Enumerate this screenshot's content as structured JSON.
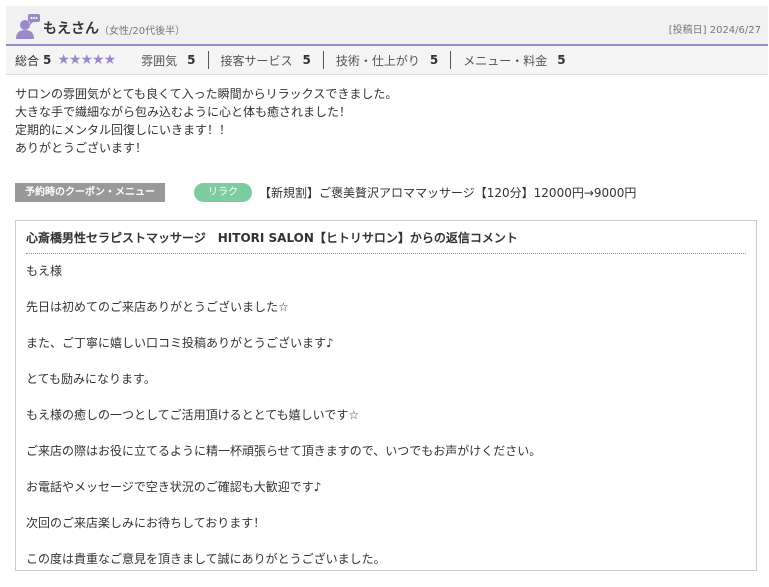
{
  "reviewer": {
    "name": "もえさん",
    "attributes": "（女性/20代後半）",
    "date": "[投稿日] 2024/6/27"
  },
  "ratings": {
    "total_label": "総合",
    "total_value": "5",
    "stars": "★★★★★",
    "categories": [
      {
        "label": "雰囲気",
        "value": "5"
      },
      {
        "label": "接客サービス",
        "value": "5"
      },
      {
        "label": "技術・仕上がり",
        "value": "5"
      },
      {
        "label": "メニュー・料金",
        "value": "5"
      }
    ]
  },
  "review_lines": [
    "サロンの雰囲気がとても良くて入った瞬間からリラックスできました。",
    "大きな手で繊細ながら包み込むように心と体も癒されました！",
    "定期的にメンタル回復しにいきます！！",
    "ありがとうございます！"
  ],
  "coupon": {
    "tag": "予約時のクーポン・メニュー",
    "badge": "リラク",
    "text": "【新規割】ご褒美贅沢アロママッサージ【120分】12000円→9000円"
  },
  "reply": {
    "title": "心斎橋男性セラピストマッサージ　HITORI SALON【ヒトリサロン】からの返信コメント",
    "lines": [
      "もえ様",
      "先日は初めてのご来店ありがとうございました☆",
      "また、ご丁寧に嬉しい口コミ投稿ありがとうございます♪",
      "とても励みになります。",
      "もえ様の癒しの一つとしてご活用頂けるととても嬉しいです☆",
      "ご来店の際はお役に立てるように精一杯頑張らせて頂きますので、いつでもお声がけください。",
      "お電話やメッセージで空き状況のご確認も大歓迎です♪",
      "次回のご来店楽しみにお待ちしております！",
      "この度は貴重なご意見を頂きまして誠にありがとうございました。"
    ]
  },
  "colors": {
    "accent": "#9c89c9",
    "badge": "#7dcba0",
    "tag": "#999999"
  }
}
